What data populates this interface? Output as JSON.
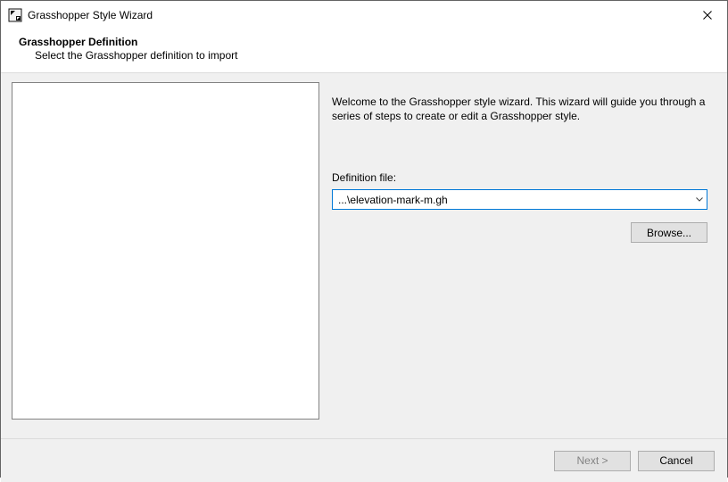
{
  "titlebar": {
    "title": "Grasshopper Style Wizard"
  },
  "header": {
    "title": "Grasshopper Definition",
    "subtitle": "Select the Grasshopper definition to import"
  },
  "main": {
    "intro": "Welcome to the Grasshopper style wizard. This wizard will guide you through a series of steps to create or edit a Grasshopper style.",
    "definition_label": "Definition file:",
    "definition_value": "...\\elevation-mark-m.gh",
    "browse_label": "Browse..."
  },
  "footer": {
    "next_label": "Next >",
    "cancel_label": "Cancel"
  }
}
